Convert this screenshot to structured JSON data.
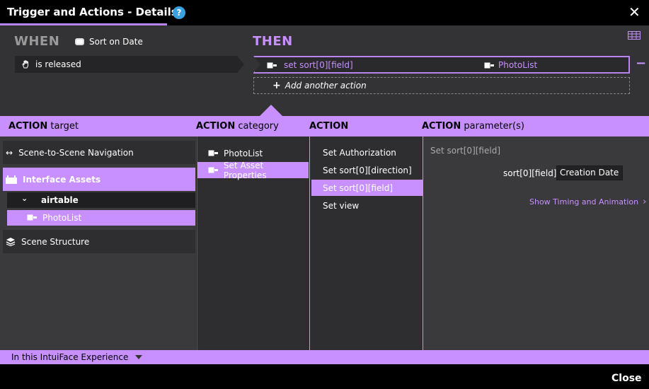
{
  "window": {
    "title": "Trigger and Actions - Details",
    "help_icon": "?",
    "close_icon": "✕"
  },
  "when": {
    "label": "WHEN",
    "source": "Sort on Date",
    "event": "is released"
  },
  "then": {
    "label": "THEN",
    "action": {
      "name": "set sort[0][field]",
      "asset": "PhotoList"
    },
    "remove": "−",
    "add_label": "Add another action",
    "add_icon": "+"
  },
  "headers": {
    "target": {
      "bold": "ACTION",
      "rest": "target"
    },
    "category": {
      "bold": "ACTION",
      "rest": "category"
    },
    "action": {
      "bold": "ACTION",
      "rest": ""
    },
    "parameters": {
      "bold": "ACTION",
      "rest": "parameter(s)"
    }
  },
  "targets": [
    {
      "label": "Scene-to-Scene Navigation",
      "icon": "double-arrow-icon"
    },
    {
      "label": "Interface Assets",
      "icon": "interface-assets-icon"
    },
    {
      "label": "airtable",
      "icon": "chevron-down-icon"
    },
    {
      "label": "PhotoList",
      "icon": "asset-icon"
    },
    {
      "label": "Scene Structure",
      "icon": "layers-icon"
    }
  ],
  "categories": [
    {
      "label": "PhotoList"
    },
    {
      "label": "Set Asset Properties"
    }
  ],
  "actions": [
    {
      "label": "Set Authorization"
    },
    {
      "label": "Set sort[0][direction]"
    },
    {
      "label": "Set sort[0][field]"
    },
    {
      "label": "Set view"
    }
  ],
  "parameters": {
    "title": "Set sort[0][field]",
    "field_label": "sort[0][field]",
    "field_value": "Creation Date",
    "timing_link": "Show Timing and Animation"
  },
  "footer": {
    "scope": "In this IntuiFace Experience",
    "close": "Close"
  },
  "colors": {
    "accent": "#c890ff",
    "panel": "#3a3a3c",
    "background": "#333335"
  }
}
